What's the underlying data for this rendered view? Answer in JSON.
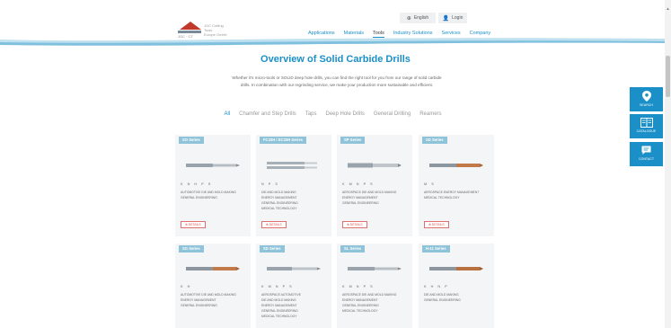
{
  "header": {
    "logo_text": "JGC Cutting Tools\nEurope GmbH",
    "logo_sub": "JGC · CT",
    "language_label": "English",
    "login_label": "Login",
    "nav": [
      "Applications",
      "Materials",
      "Tools",
      "Industry Solutions",
      "Services",
      "Company"
    ],
    "active_nav": "Tools"
  },
  "main": {
    "title": "Overview of Solid Carbide Drills",
    "intro": "Whether it's micro-tools or SOLID deep hole drills, you can find the right tool for you from our range of solid carbide drills. In combination with our regrinding service, we make your production more sustainable and efficient.",
    "filters": [
      "All",
      "Chamfer and Step Drills",
      "Taps",
      "Deep Hole Drills",
      "General Drilling",
      "Reamers"
    ],
    "active_filter": "All",
    "details_label": "⊕ DETAILS"
  },
  "cards": [
    {
      "tag": "SO Series",
      "mats": "K  N  H  P  S",
      "inds": [
        "AUTOMOTIVE   DIE AND MOLD MAKING",
        "GENERAL ENGINEERING"
      ],
      "drill": "plain"
    },
    {
      "tag": "FC33H / EC33H Series",
      "mats": "N  P  S",
      "inds": [
        "DIE AND MOLD MAKING",
        "ENERGY MANAGEMENT",
        "GENERAL ENGINEERING",
        "MEDICAL TECHNOLOGY"
      ],
      "drill": "slim"
    },
    {
      "tag": "SP Series",
      "mats": "K  M  N  P  S",
      "inds": [
        "AEROSPACE   DIE AND MOLD MAKING",
        "ENERGY MANAGEMENT",
        "GENERAL ENGINEERING"
      ],
      "drill": "plain"
    },
    {
      "tag": "SD Series",
      "mats": "M  S",
      "inds": [
        "AEROSPACE   ENERGY MANAGEMENT",
        "MEDICAL TECHNOLOGY"
      ],
      "drill": "bronze"
    },
    {
      "tag": "SG Series",
      "mats": "K  H",
      "inds": [
        "AUTOMOTIVE   DIE AND MOLD MAKING",
        "ENERGY MANAGEMENT",
        "GENERAL ENGINEERING"
      ],
      "drill": "bronze"
    },
    {
      "tag": "SD Series",
      "mats": "K  M  N  P  S",
      "inds": [
        "AEROSPACE   AUTOMOTIVE",
        "DIE AND MOLD MAKING",
        "ENERGY MANAGEMENT",
        "GENERAL ENGINEERING",
        "MEDICAL TECHNOLOGY"
      ],
      "drill": "plain"
    },
    {
      "tag": "SL Series",
      "mats": "K  M  N  P  S",
      "inds": [
        "AEROSPACE   DIE AND MOLD MAKING",
        "ENERGY MANAGEMENT",
        "GENERAL ENGINEERING",
        "MEDICAL TECHNOLOGY"
      ],
      "drill": "plain"
    },
    {
      "tag": "H-11 Series",
      "mats": "K  H  N  P",
      "inds": [
        "DIE AND MOLD MAKING",
        "GENERAL ENGINEERING"
      ],
      "drill": "bronze"
    }
  ],
  "side_buttons": [
    {
      "label": "SEARCH",
      "icon": "location-pin-icon"
    },
    {
      "label": "CATALOGUE",
      "icon": "catalogue-book-icon"
    },
    {
      "label": "CONTACT",
      "icon": "chat-bubble-icon"
    }
  ],
  "colors": {
    "accent": "#1a8fc8",
    "tag": "#8ec3d9",
    "details": "#e05050",
    "card_bg": "#f4f5f6"
  }
}
